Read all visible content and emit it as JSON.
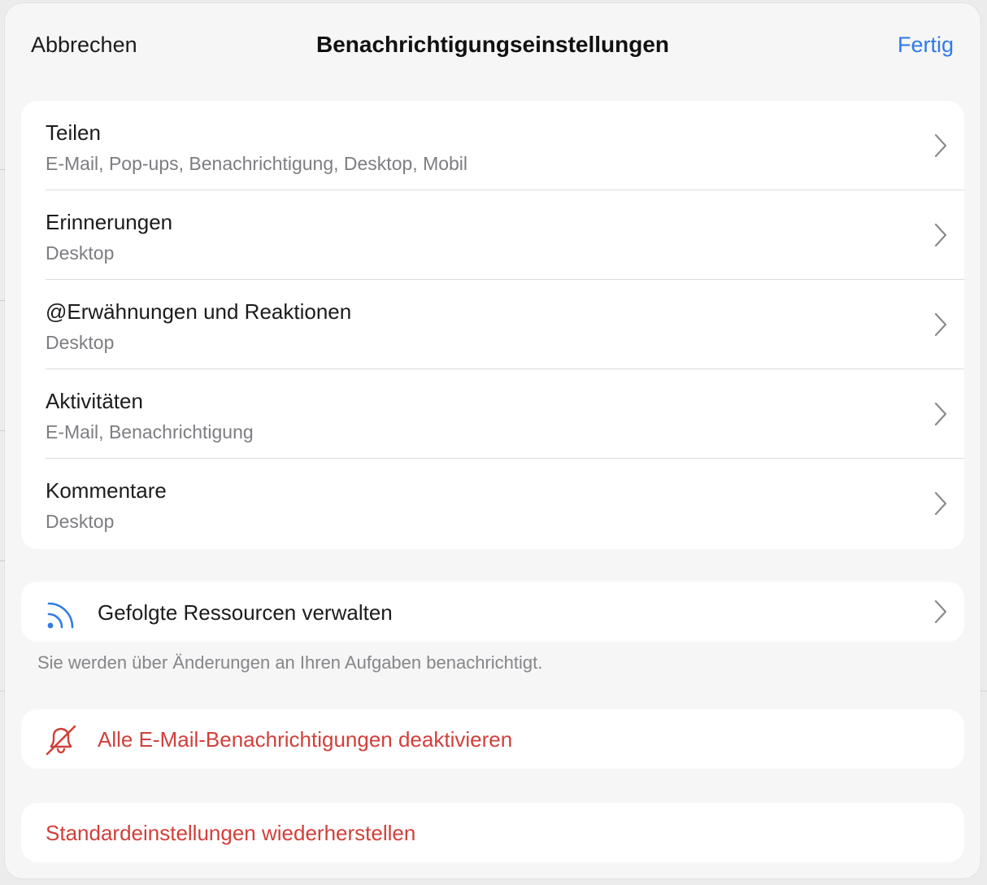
{
  "header": {
    "cancel_label": "Abbrechen",
    "title": "Benachrichtigungseinstellungen",
    "done_label": "Fertig"
  },
  "categories": [
    {
      "title": "Teilen",
      "subtitle": "E-Mail, Pop-ups, Benachrichtigung, Desktop, Mobil"
    },
    {
      "title": "Erinnerungen",
      "subtitle": "Desktop"
    },
    {
      "title": "@Erwähnungen und Reaktionen",
      "subtitle": "Desktop"
    },
    {
      "title": "Aktivitäten",
      "subtitle": "E-Mail, Benachrichtigung"
    },
    {
      "title": "Kommentare",
      "subtitle": "Desktop"
    }
  ],
  "followed": {
    "label": "Gefolgte Ressourcen verwalten",
    "icon": "rss-icon",
    "hint": "Sie werden über Änderungen an Ihren Aufgaben benachrichtigt."
  },
  "disable_email": {
    "label": "Alle E-Mail-Benachrichtigungen deaktivieren",
    "icon": "bell-slash-icon"
  },
  "restore": {
    "label": "Standardeinstellungen wiederherstellen"
  },
  "colors": {
    "accent": "#2f7bea",
    "destructive": "#d1403b",
    "background": "#f6f6f6"
  }
}
